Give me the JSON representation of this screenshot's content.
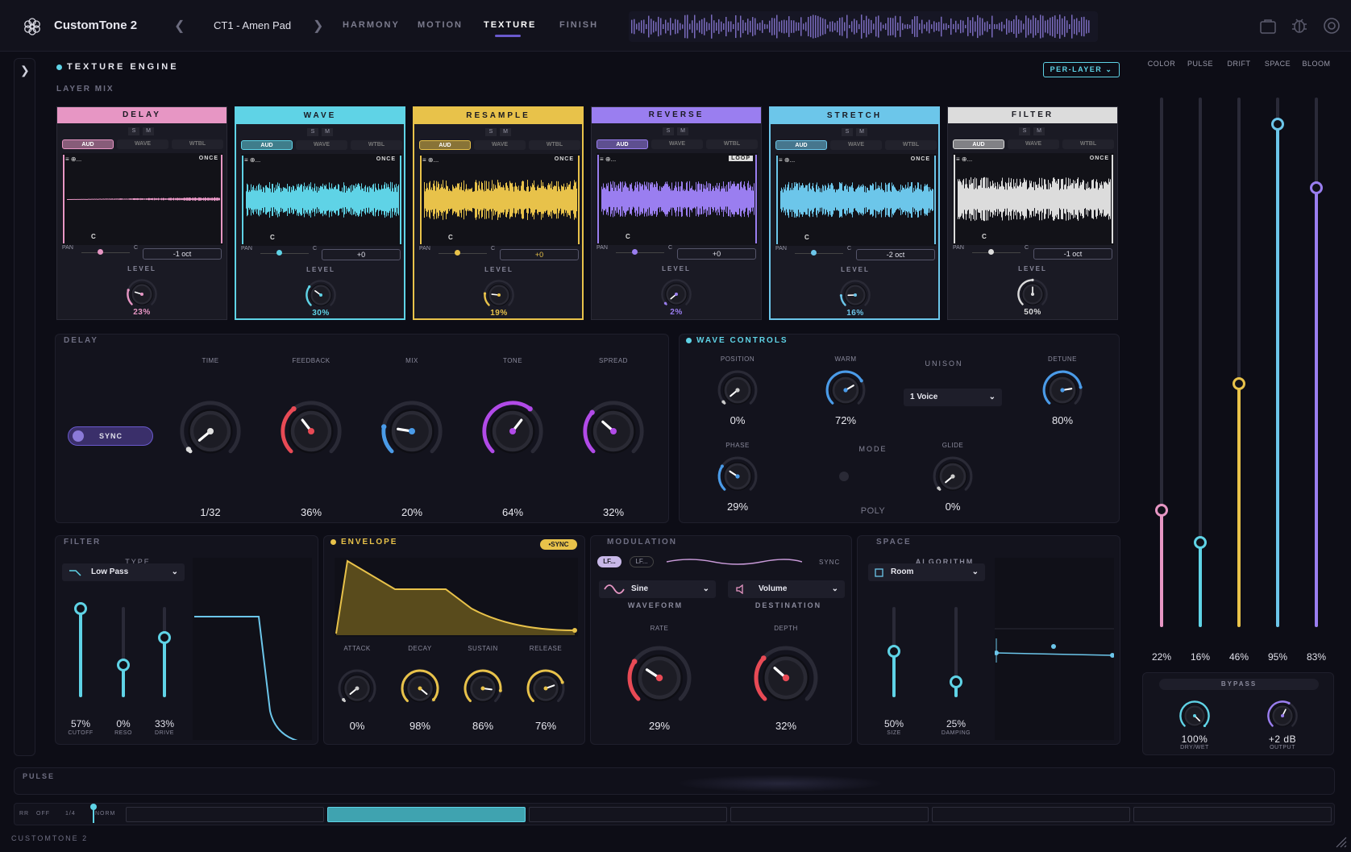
{
  "app": {
    "name": "CustomTone 2",
    "preset": "CT1 - Amen Pad",
    "footer": "CUSTOMTONE 2"
  },
  "tabs": [
    {
      "label": "HARMONY"
    },
    {
      "label": "MOTION"
    },
    {
      "label": "TEXTURE"
    },
    {
      "label": "FINISH"
    }
  ],
  "engine": {
    "title": "TEXTURE ENGINE",
    "mode": "PER-LAYER",
    "layer_mix": "LAYER MIX"
  },
  "layers": [
    {
      "name": "DELAY",
      "color": "#e796c4",
      "mode": "ONCE",
      "oct": "-1 oct",
      "level": "23%",
      "note": "C"
    },
    {
      "name": "WAVE",
      "color": "#5fd3e6",
      "mode": "ONCE",
      "oct": "+0",
      "level": "30%",
      "note": "C"
    },
    {
      "name": "RESAMPLE",
      "color": "#e8c24a",
      "mode": "ONCE",
      "oct": "+0",
      "level": "19%",
      "note": "C"
    },
    {
      "name": "REVERSE",
      "color": "#9a7ef0",
      "mode": "LOOP",
      "oct": "+0",
      "level": "2%",
      "note": "C"
    },
    {
      "name": "STRETCH",
      "color": "#6cc6ea",
      "mode": "ONCE",
      "oct": "-2 oct",
      "level": "16%",
      "note": "C"
    },
    {
      "name": "FILTER",
      "color": "#dcdcdc",
      "mode": "ONCE",
      "oct": "-1 oct",
      "level": "50%",
      "note": "C"
    }
  ],
  "layer_labels": {
    "s": "S",
    "m": "M",
    "aud": "AUD",
    "wave": "WAVE",
    "wtbl": "WTBL",
    "pan": "PAN",
    "c": "C",
    "level": "LEVEL",
    "eq": "≡ ⊕..."
  },
  "delay": {
    "title": "DELAY",
    "sync": "SYNC",
    "knobs": [
      {
        "label": "TIME",
        "value": "1/32"
      },
      {
        "label": "FEEDBACK",
        "value": "36%"
      },
      {
        "label": "MIX",
        "value": "20%"
      },
      {
        "label": "TONE",
        "value": "64%"
      },
      {
        "label": "SPREAD",
        "value": "32%"
      }
    ]
  },
  "wave": {
    "title": "WAVE CONTROLS",
    "position": {
      "label": "POSITION",
      "value": "0%"
    },
    "warm": {
      "label": "WARM",
      "value": "72%"
    },
    "unison": {
      "label": "UNISON",
      "value": "1 Voice"
    },
    "detune": {
      "label": "DETUNE",
      "value": "80%"
    },
    "phase": {
      "label": "PHASE",
      "value": "29%"
    },
    "mode": {
      "label": "MODE",
      "value": "POLY"
    },
    "glide": {
      "label": "GLIDE",
      "value": "0%"
    }
  },
  "filter": {
    "title": "FILTER",
    "type_label": "TYPE",
    "type": "Low Pass",
    "faders": [
      {
        "label": "CUTOFF",
        "value": "57%"
      },
      {
        "label": "RESO",
        "value": "0%"
      },
      {
        "label": "DRIVE",
        "value": "33%"
      }
    ]
  },
  "envelope": {
    "title": "ENVELOPE",
    "sync": "SYNC",
    "knobs": [
      {
        "label": "ATTACK",
        "value": "0%"
      },
      {
        "label": "DECAY",
        "value": "98%"
      },
      {
        "label": "SUSTAIN",
        "value": "86%"
      },
      {
        "label": "RELEASE",
        "value": "76%"
      }
    ]
  },
  "modulation": {
    "title": "MODULATION",
    "lfo1": "LF...",
    "lfo2": "LF...",
    "sync": "SYNC",
    "waveform": "Sine",
    "waveform_label": "WAVEFORM",
    "destination": "Volume",
    "destination_label": "DESTINATION",
    "rate": {
      "label": "RATE",
      "value": "29%"
    },
    "depth": {
      "label": "DEPTH",
      "value": "32%"
    }
  },
  "space": {
    "title": "SPACE",
    "algorithm_label": "ALGORITHM",
    "algorithm": "Room",
    "faders": [
      {
        "label": "SIZE",
        "value": "50%"
      },
      {
        "label": "DAMPING",
        "value": "25%"
      }
    ]
  },
  "macros": [
    {
      "label": "COLOR",
      "value": "22%",
      "color": "#e796c4"
    },
    {
      "label": "PULSE",
      "value": "16%",
      "color": "#5fd3e6"
    },
    {
      "label": "DRIFT",
      "value": "46%",
      "color": "#e8c24a"
    },
    {
      "label": "SPACE",
      "value": "95%",
      "color": "#6cc6ea"
    },
    {
      "label": "BLOOM",
      "value": "83%",
      "color": "#9a7ef0"
    }
  ],
  "bypass": {
    "title": "BYPASS",
    "drywet": {
      "label": "DRY/WET",
      "value": "100%"
    },
    "output": {
      "label": "OUTPUT",
      "value": "+2 dB"
    }
  },
  "pulse": {
    "title": "PULSE",
    "rr": "RR",
    "off": "OFF",
    "rate": "1/4",
    "norm": "NORM"
  }
}
